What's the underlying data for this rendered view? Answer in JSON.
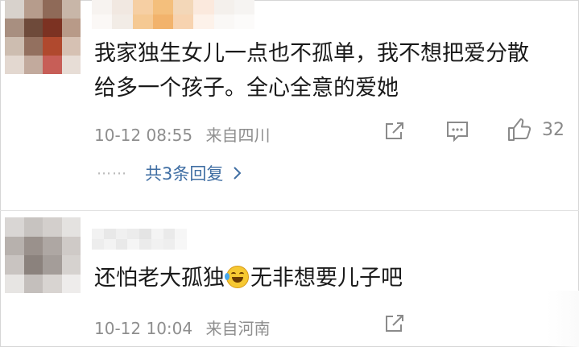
{
  "comments": [
    {
      "text": "我家独生女儿一点也不孤单，我不想把爱分散给多一个孩子。全心全意的爱她",
      "time": "10-12 08:55",
      "location": "来自四川",
      "likes": "32",
      "replies_label": "共3条回复",
      "avatar_colors": [
        "#d8d2cc",
        "#b69c8c",
        "#8f6a58",
        "#c8b6a8",
        "#a88f80",
        "#6e4a3a",
        "#7c3222",
        "#b89a88",
        "#cdbdb0",
        "#93705f",
        "#b0492e",
        "#d6c1b3",
        "#e3d8d0",
        "#c2aa9d",
        "#c75e57",
        "#e7ddd6"
      ],
      "username_colors": [
        "#f7f3f0",
        "#f1e8e1",
        "#f6cfa3",
        "#f4bf7c",
        "#f3d7b8",
        "#fbe9dd",
        "#f4f0ec",
        "#f6f4f2",
        "#fbf8f6",
        "#f2ece6",
        "#f5c993",
        "#f2b36c",
        "#f7d3b0",
        "#fdf2ea",
        "#faf8f6",
        "#fcfbfa"
      ],
      "icons": {
        "share": "share-icon",
        "reply": "comment-icon",
        "like": "thumbs-up-icon"
      }
    },
    {
      "text_before": "还怕老大孤独",
      "text_after": "无非想要儿子吧",
      "emoji": "laughing-tears-emoji",
      "time": "10-12 10:04",
      "location": "来自河南",
      "avatar_colors": [
        "#d9d6d4",
        "#c7c3c0",
        "#d3cfcc",
        "#e4e2e0",
        "#b7b1ad",
        "#9a918c",
        "#aea7a3",
        "#cfcac7",
        "#c9c4c1",
        "#8b827d",
        "#a49d99",
        "#d6d2cf",
        "#e7e5e3",
        "#c4bfbc",
        "#d8d4d1",
        "#eeeceb"
      ],
      "username_colors": [
        "#f2f2f2",
        "#e8e8e8",
        "#f0f0f0",
        "#ececec",
        "#e4e4e4",
        "#f4f4f4",
        "#eaeaea",
        "#f6f6f6",
        "#ededed",
        "#f3f3f3",
        "#e9e9e9",
        "#f5f5f5",
        "#ebebeb",
        "#f1f1f1",
        "#eeeeee",
        "#f7f7f7"
      ],
      "icons": {
        "share": "share-icon"
      }
    }
  ]
}
